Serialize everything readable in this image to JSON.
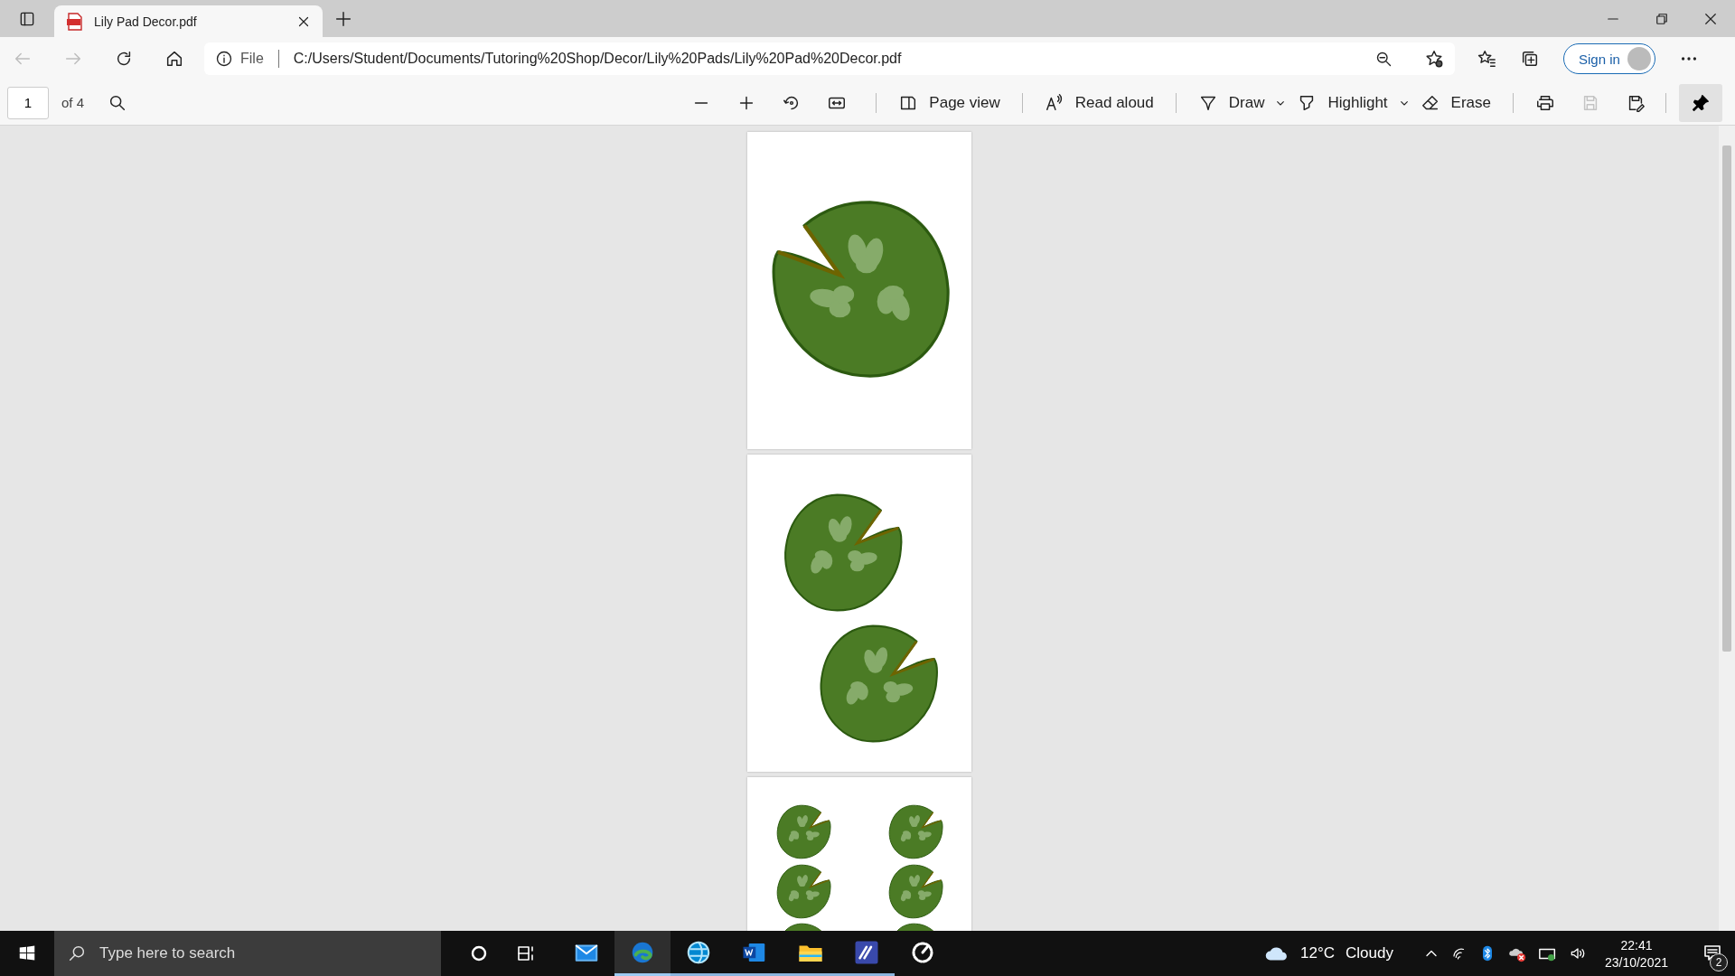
{
  "tabs": [
    {
      "label": "Lily Pad Decor.pdf",
      "selected": true
    }
  ],
  "address_bar": {
    "back_disabled": true,
    "forward_disabled": true,
    "scheme": "File",
    "url": "C:/Users/Student/Documents/Tutoring%20Shop/Decor/Lily%20Pads/Lily%20Pad%20Decor.pdf",
    "sign_in": "Sign in"
  },
  "pdf_toolbar": {
    "page": "1",
    "page_count": "of 4",
    "tools": [
      {
        "kind": "page-view",
        "label": "Page view"
      },
      {
        "kind": "read-aloud",
        "label": "Read aloud"
      },
      {
        "kind": "draw",
        "label": "Draw"
      },
      {
        "kind": "highlight",
        "label": "Highlight"
      },
      {
        "kind": "erase",
        "label": "Erase"
      }
    ],
    "save_disabled": true,
    "pinned": true
  },
  "taskbar": {
    "search_placeholder": "Type here to search",
    "apps": [
      {
        "kind": "mail",
        "running": false,
        "active": false
      },
      {
        "kind": "edge",
        "running": true,
        "active": true
      },
      {
        "kind": "globe",
        "running": true,
        "active": false
      },
      {
        "kind": "word",
        "running": true,
        "active": false
      },
      {
        "kind": "folder",
        "running": true,
        "active": false
      },
      {
        "kind": "vs",
        "running": true,
        "active": false
      },
      {
        "kind": "dial",
        "running": false,
        "active": false
      }
    ],
    "temperature": "12°C",
    "weather": "Cloudy",
    "time": "22:41",
    "date": "23/10/2021",
    "notifications": "2"
  }
}
